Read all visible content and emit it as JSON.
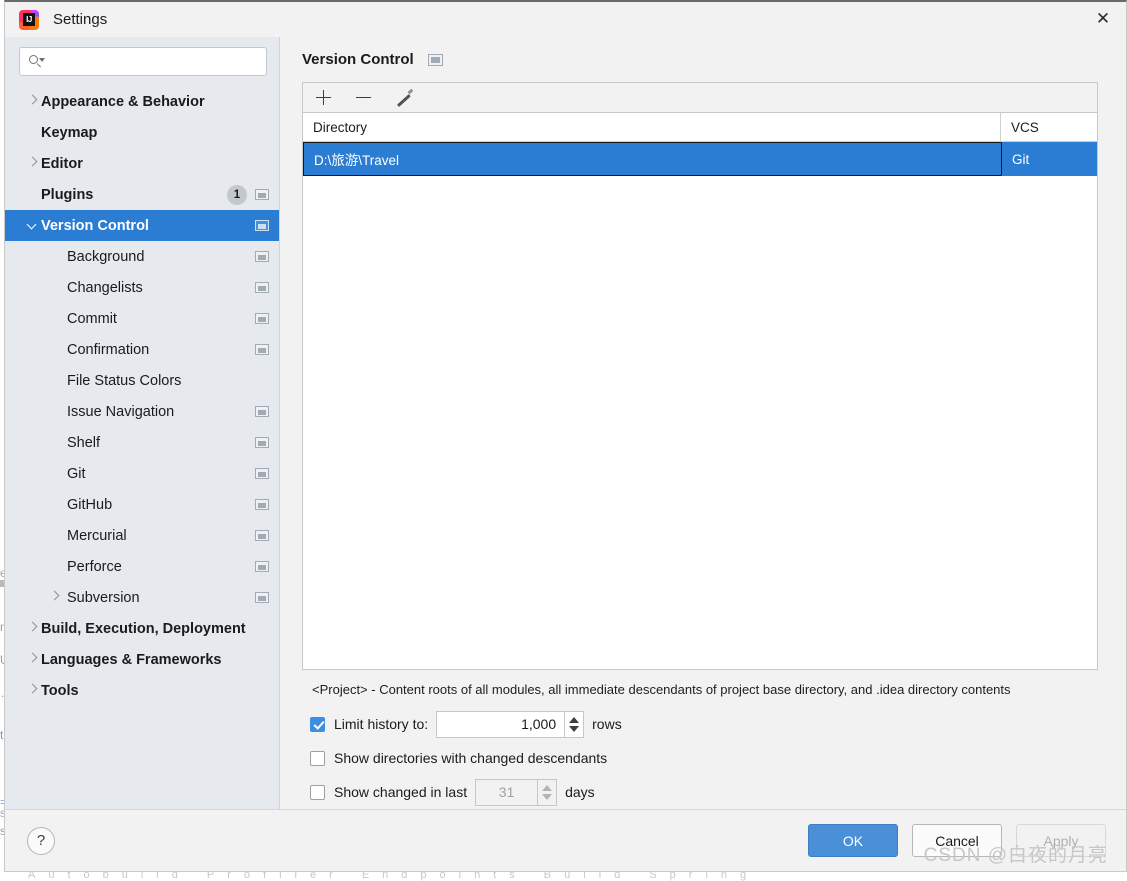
{
  "window": {
    "title": "Settings",
    "logo_icon": "intellij-idea-logo",
    "close_icon": "close-icon"
  },
  "search": {
    "value": "",
    "placeholder": "",
    "icon": "search-icon"
  },
  "sidebar": {
    "items": [
      {
        "label": "Appearance & Behavior",
        "level": "top",
        "arrow": "right",
        "bold": true,
        "badge": null,
        "panel_icon": false
      },
      {
        "label": "Keymap",
        "level": "top",
        "arrow": "none",
        "bold": true,
        "badge": null,
        "panel_icon": false
      },
      {
        "label": "Editor",
        "level": "top",
        "arrow": "right",
        "bold": true,
        "badge": null,
        "panel_icon": false
      },
      {
        "label": "Plugins",
        "level": "top",
        "arrow": "none",
        "bold": true,
        "badge": "1",
        "panel_icon": true
      },
      {
        "label": "Version Control",
        "level": "top",
        "arrow": "down",
        "bold": true,
        "badge": null,
        "panel_icon": true,
        "selected": true
      },
      {
        "label": "Background",
        "level": "child",
        "arrow": "none",
        "badge": null,
        "panel_icon": true
      },
      {
        "label": "Changelists",
        "level": "child",
        "arrow": "none",
        "badge": null,
        "panel_icon": true
      },
      {
        "label": "Commit",
        "level": "child",
        "arrow": "none",
        "badge": null,
        "panel_icon": true
      },
      {
        "label": "Confirmation",
        "level": "child",
        "arrow": "none",
        "badge": null,
        "panel_icon": true
      },
      {
        "label": "File Status Colors",
        "level": "child",
        "arrow": "none",
        "badge": null,
        "panel_icon": false
      },
      {
        "label": "Issue Navigation",
        "level": "child",
        "arrow": "none",
        "badge": null,
        "panel_icon": true
      },
      {
        "label": "Shelf",
        "level": "child",
        "arrow": "none",
        "badge": null,
        "panel_icon": true
      },
      {
        "label": "Git",
        "level": "child",
        "arrow": "none",
        "badge": null,
        "panel_icon": true
      },
      {
        "label": "GitHub",
        "level": "child",
        "arrow": "none",
        "badge": null,
        "panel_icon": true
      },
      {
        "label": "Mercurial",
        "level": "child",
        "arrow": "none",
        "badge": null,
        "panel_icon": true
      },
      {
        "label": "Perforce",
        "level": "child",
        "arrow": "none",
        "badge": null,
        "panel_icon": true
      },
      {
        "label": "Subversion",
        "level": "child",
        "arrow": "right",
        "badge": null,
        "panel_icon": true
      },
      {
        "label": "Build, Execution, Deployment",
        "level": "top",
        "arrow": "right",
        "bold": true,
        "badge": null,
        "panel_icon": false
      },
      {
        "label": "Languages & Frameworks",
        "level": "top",
        "arrow": "right",
        "bold": true,
        "badge": null,
        "panel_icon": false
      },
      {
        "label": "Tools",
        "level": "top",
        "arrow": "right",
        "bold": true,
        "badge": null,
        "panel_icon": false
      }
    ]
  },
  "main": {
    "title": "Version Control",
    "title_icon": "panel-icon",
    "toolbar": [
      {
        "name": "add-button",
        "icon": "plus-icon"
      },
      {
        "name": "remove-button",
        "icon": "minus-icon"
      },
      {
        "name": "edit-button",
        "icon": "pencil-icon"
      }
    ],
    "table": {
      "columns": [
        "Directory",
        "VCS"
      ],
      "rows": [
        {
          "directory": "D:\\旅游\\Travel",
          "vcs": "Git",
          "selected": true
        }
      ]
    },
    "note": "<Project> - Content roots of all modules, all immediate descendants of project base directory, and .idea directory contents",
    "options": [
      {
        "name": "limit-history",
        "label": "Limit history to:",
        "checked": true,
        "spinner": {
          "value": "1,000",
          "disabled": false
        },
        "suffix": "rows"
      },
      {
        "name": "show-directories-changed-descendants",
        "label": "Show directories with changed descendants",
        "checked": false,
        "spinner": null,
        "suffix": ""
      },
      {
        "name": "show-changed-in-last",
        "label": "Show changed in last",
        "checked": false,
        "spinner": {
          "value": "31",
          "disabled": true
        },
        "suffix": "days"
      }
    ]
  },
  "footer": {
    "help_label": "?",
    "ok_label": "OK",
    "cancel_label": "Cancel",
    "apply_label": "Apply",
    "watermark": "CSDN @白夜的月亮"
  },
  "behind": {
    "fragments": [
      "e",
      "n",
      "U",
      ".",
      "t",
      "=",
      "s",
      "s"
    ],
    "bottom_bar": "Autobuild   Profiler   Endpoints   Build   Spring"
  },
  "colors": {
    "accent": "#2b7cd3",
    "primary_button": "#4a90d9",
    "sidebar_bg": "#e6eaee",
    "dialog_bg": "#f2f2f2",
    "checkbox_on": "#3c8fe0"
  }
}
